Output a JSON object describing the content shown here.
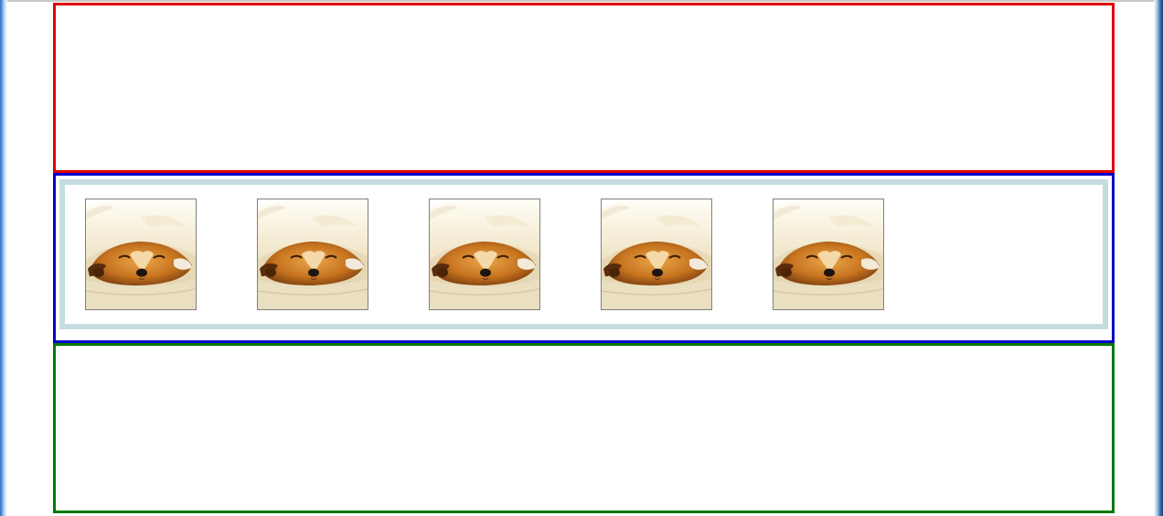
{
  "window": {
    "title": ""
  },
  "regions": {
    "top": {
      "label": "",
      "border_color": "#e00000"
    },
    "middle": {
      "label": "",
      "border_color": "#0000cc",
      "panel_border_color": "#c4dde0"
    },
    "bottom": {
      "label": "",
      "border_color": "#007a00"
    }
  },
  "gallery": {
    "items": [
      {
        "image": "sleeping-puppy-under-blanket"
      },
      {
        "image": "sleeping-puppy-under-blanket"
      },
      {
        "image": "sleeping-puppy-under-blanket"
      },
      {
        "image": "sleeping-puppy-under-blanket"
      },
      {
        "image": "sleeping-puppy-under-blanket"
      }
    ]
  }
}
